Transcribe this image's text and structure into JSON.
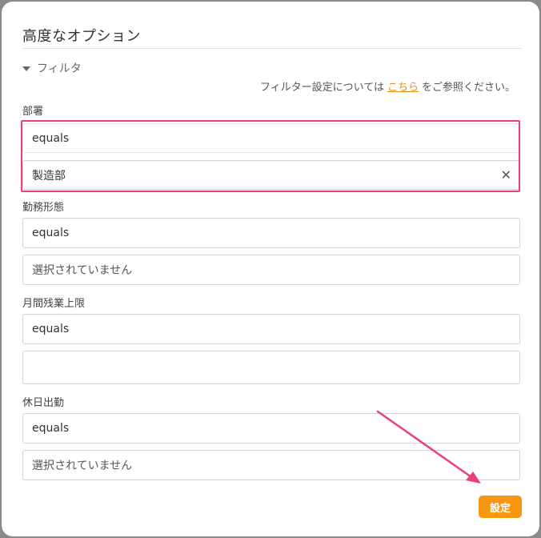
{
  "dialog": {
    "title": "高度なオプション"
  },
  "filter": {
    "toggle_label": "フィルタ"
  },
  "help": {
    "prefix": "フィルター設定については",
    "link": "こちら",
    "suffix": "をご参照ください。"
  },
  "fields": {
    "department": {
      "label": "部署",
      "operator": "equals",
      "value": "製造部"
    },
    "work_style": {
      "label": "勤務形態",
      "operator": "equals",
      "value": "選択されていません"
    },
    "overtime_limit": {
      "label": "月間残業上限",
      "operator": "equals",
      "value": ""
    },
    "holiday_work": {
      "label": "休日出勤",
      "operator": "equals",
      "value": "選択されていません"
    }
  },
  "actions": {
    "set_label": "設定"
  },
  "annotation": {
    "highlight_color": "#ea3f78",
    "arrow_color": "#ea3f78",
    "accent": "#f7960f"
  },
  "icons": {
    "clear": "close-icon",
    "toggle": "caret-down-icon"
  }
}
